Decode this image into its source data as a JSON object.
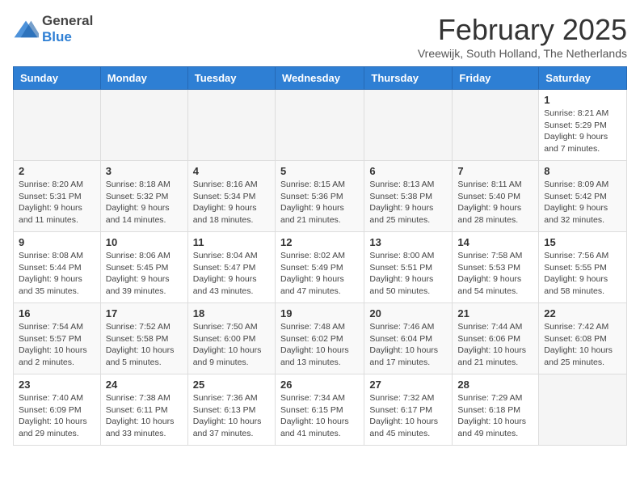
{
  "header": {
    "logo_general": "General",
    "logo_blue": "Blue",
    "month_title": "February 2025",
    "location": "Vreewijk, South Holland, The Netherlands"
  },
  "weekdays": [
    "Sunday",
    "Monday",
    "Tuesday",
    "Wednesday",
    "Thursday",
    "Friday",
    "Saturday"
  ],
  "weeks": [
    [
      {
        "day": "",
        "info": ""
      },
      {
        "day": "",
        "info": ""
      },
      {
        "day": "",
        "info": ""
      },
      {
        "day": "",
        "info": ""
      },
      {
        "day": "",
        "info": ""
      },
      {
        "day": "",
        "info": ""
      },
      {
        "day": "1",
        "info": "Sunrise: 8:21 AM\nSunset: 5:29 PM\nDaylight: 9 hours and 7 minutes."
      }
    ],
    [
      {
        "day": "2",
        "info": "Sunrise: 8:20 AM\nSunset: 5:31 PM\nDaylight: 9 hours and 11 minutes."
      },
      {
        "day": "3",
        "info": "Sunrise: 8:18 AM\nSunset: 5:32 PM\nDaylight: 9 hours and 14 minutes."
      },
      {
        "day": "4",
        "info": "Sunrise: 8:16 AM\nSunset: 5:34 PM\nDaylight: 9 hours and 18 minutes."
      },
      {
        "day": "5",
        "info": "Sunrise: 8:15 AM\nSunset: 5:36 PM\nDaylight: 9 hours and 21 minutes."
      },
      {
        "day": "6",
        "info": "Sunrise: 8:13 AM\nSunset: 5:38 PM\nDaylight: 9 hours and 25 minutes."
      },
      {
        "day": "7",
        "info": "Sunrise: 8:11 AM\nSunset: 5:40 PM\nDaylight: 9 hours and 28 minutes."
      },
      {
        "day": "8",
        "info": "Sunrise: 8:09 AM\nSunset: 5:42 PM\nDaylight: 9 hours and 32 minutes."
      }
    ],
    [
      {
        "day": "9",
        "info": "Sunrise: 8:08 AM\nSunset: 5:44 PM\nDaylight: 9 hours and 35 minutes."
      },
      {
        "day": "10",
        "info": "Sunrise: 8:06 AM\nSunset: 5:45 PM\nDaylight: 9 hours and 39 minutes."
      },
      {
        "day": "11",
        "info": "Sunrise: 8:04 AM\nSunset: 5:47 PM\nDaylight: 9 hours and 43 minutes."
      },
      {
        "day": "12",
        "info": "Sunrise: 8:02 AM\nSunset: 5:49 PM\nDaylight: 9 hours and 47 minutes."
      },
      {
        "day": "13",
        "info": "Sunrise: 8:00 AM\nSunset: 5:51 PM\nDaylight: 9 hours and 50 minutes."
      },
      {
        "day": "14",
        "info": "Sunrise: 7:58 AM\nSunset: 5:53 PM\nDaylight: 9 hours and 54 minutes."
      },
      {
        "day": "15",
        "info": "Sunrise: 7:56 AM\nSunset: 5:55 PM\nDaylight: 9 hours and 58 minutes."
      }
    ],
    [
      {
        "day": "16",
        "info": "Sunrise: 7:54 AM\nSunset: 5:57 PM\nDaylight: 10 hours and 2 minutes."
      },
      {
        "day": "17",
        "info": "Sunrise: 7:52 AM\nSunset: 5:58 PM\nDaylight: 10 hours and 5 minutes."
      },
      {
        "day": "18",
        "info": "Sunrise: 7:50 AM\nSunset: 6:00 PM\nDaylight: 10 hours and 9 minutes."
      },
      {
        "day": "19",
        "info": "Sunrise: 7:48 AM\nSunset: 6:02 PM\nDaylight: 10 hours and 13 minutes."
      },
      {
        "day": "20",
        "info": "Sunrise: 7:46 AM\nSunset: 6:04 PM\nDaylight: 10 hours and 17 minutes."
      },
      {
        "day": "21",
        "info": "Sunrise: 7:44 AM\nSunset: 6:06 PM\nDaylight: 10 hours and 21 minutes."
      },
      {
        "day": "22",
        "info": "Sunrise: 7:42 AM\nSunset: 6:08 PM\nDaylight: 10 hours and 25 minutes."
      }
    ],
    [
      {
        "day": "23",
        "info": "Sunrise: 7:40 AM\nSunset: 6:09 PM\nDaylight: 10 hours and 29 minutes."
      },
      {
        "day": "24",
        "info": "Sunrise: 7:38 AM\nSunset: 6:11 PM\nDaylight: 10 hours and 33 minutes."
      },
      {
        "day": "25",
        "info": "Sunrise: 7:36 AM\nSunset: 6:13 PM\nDaylight: 10 hours and 37 minutes."
      },
      {
        "day": "26",
        "info": "Sunrise: 7:34 AM\nSunset: 6:15 PM\nDaylight: 10 hours and 41 minutes."
      },
      {
        "day": "27",
        "info": "Sunrise: 7:32 AM\nSunset: 6:17 PM\nDaylight: 10 hours and 45 minutes."
      },
      {
        "day": "28",
        "info": "Sunrise: 7:29 AM\nSunset: 6:18 PM\nDaylight: 10 hours and 49 minutes."
      },
      {
        "day": "",
        "info": ""
      }
    ]
  ]
}
